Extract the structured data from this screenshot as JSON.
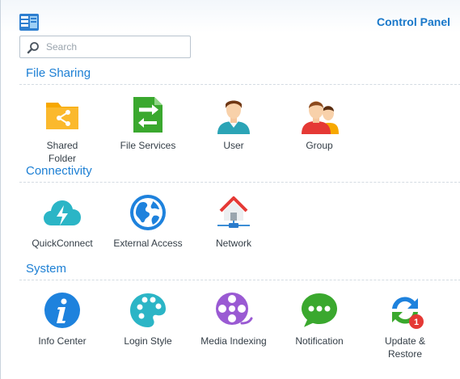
{
  "window": {
    "title": "Control Panel"
  },
  "search": {
    "placeholder": "Search",
    "value": ""
  },
  "sections": {
    "file_sharing": {
      "title": "File Sharing",
      "items": [
        {
          "label": "Shared\nFolder",
          "icon": "shared-folder-icon"
        },
        {
          "label": "File Services",
          "icon": "file-services-icon"
        },
        {
          "label": "User",
          "icon": "user-icon"
        },
        {
          "label": "Group",
          "icon": "group-icon"
        }
      ]
    },
    "connectivity": {
      "title": "Connectivity",
      "items": [
        {
          "label": "QuickConnect",
          "icon": "quickconnect-icon"
        },
        {
          "label": "External Access",
          "icon": "external-access-icon"
        },
        {
          "label": "Network",
          "icon": "network-icon"
        }
      ]
    },
    "system": {
      "title": "System",
      "items": [
        {
          "label": "Info Center",
          "icon": "info-center-icon"
        },
        {
          "label": "Login Style",
          "icon": "login-style-icon"
        },
        {
          "label": "Media Indexing",
          "icon": "media-indexing-icon"
        },
        {
          "label": "Notification",
          "icon": "notification-icon"
        },
        {
          "label": "Update &\nRestore",
          "icon": "update-restore-icon",
          "badge": "1"
        }
      ]
    }
  },
  "colors": {
    "accent": "#1c7fd4",
    "title": "#1877c9"
  }
}
